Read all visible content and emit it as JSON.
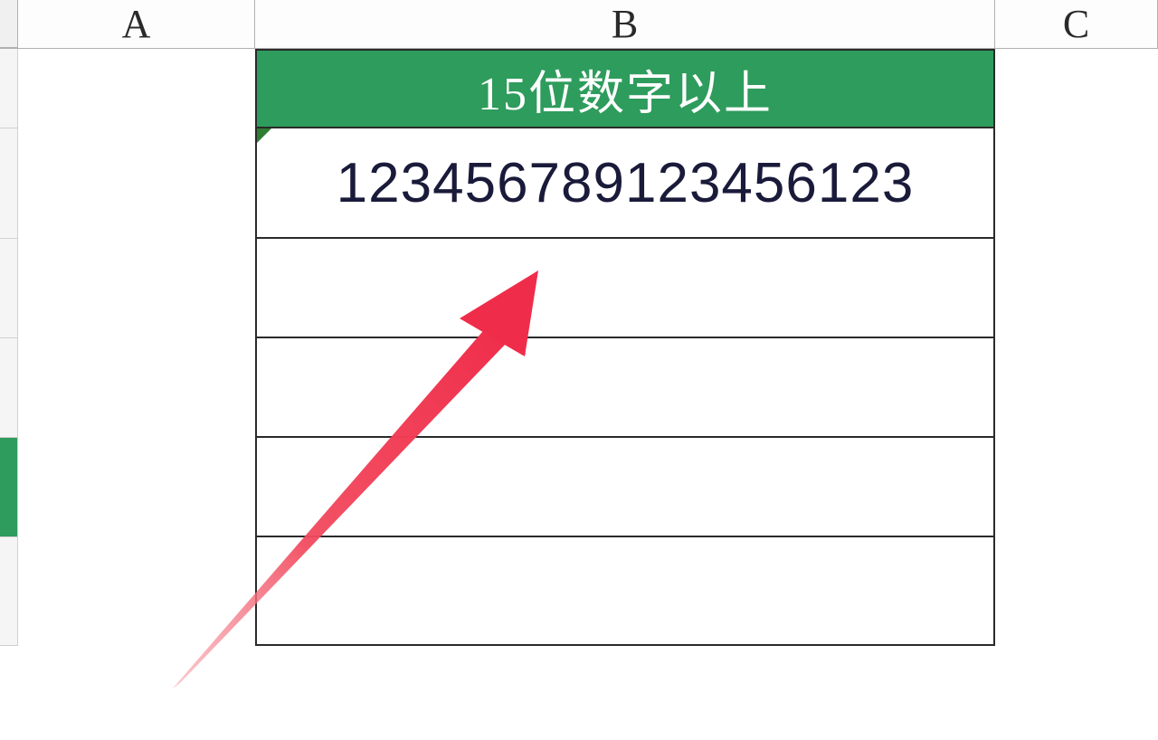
{
  "columns": {
    "a": "A",
    "b": "B",
    "c": "C"
  },
  "header_cell": {
    "text": "15位数字以上"
  },
  "data_cell": {
    "value": "123456789123456123"
  },
  "colors": {
    "header_bg": "#2e9c5c",
    "header_fg": "#ffffff",
    "data_fg": "#1a1a3a",
    "arrow": "#f24a5e"
  }
}
